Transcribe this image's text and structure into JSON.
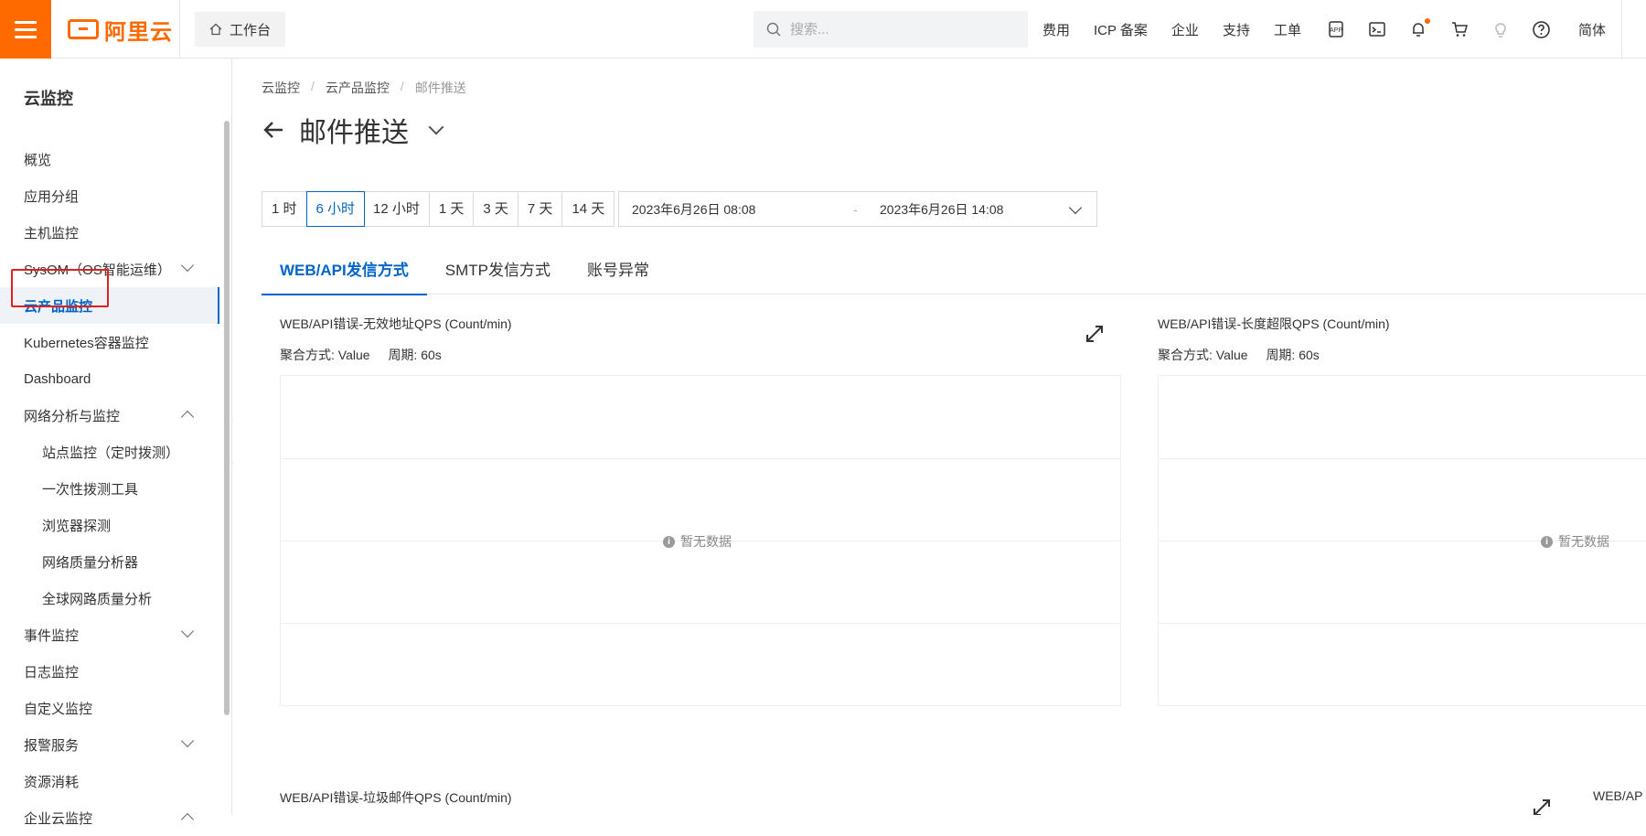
{
  "topbar": {
    "brand": "阿里云",
    "workbench_label": "工作台",
    "search_placeholder": "搜索...",
    "links": [
      "费用",
      "ICP 备案",
      "企业",
      "支持",
      "工单"
    ],
    "icons": [
      "app-icon",
      "terminal-icon",
      "bell-icon",
      "cart-icon",
      "lightbulb-icon",
      "help-icon"
    ],
    "lang": "简体"
  },
  "sidebar": {
    "title": "云监控",
    "items": [
      {
        "label": "概览",
        "level": 1
      },
      {
        "label": "应用分组",
        "level": 1
      },
      {
        "label": "主机监控",
        "level": 1
      },
      {
        "label": "SysOM（OS智能运维）",
        "level": 1,
        "expand": "down"
      },
      {
        "label": "云产品监控",
        "level": 1,
        "active": true
      },
      {
        "label": "Kubernetes容器监控",
        "level": 1
      },
      {
        "label": "Dashboard",
        "level": 1
      },
      {
        "label": "网络分析与监控",
        "level": 1,
        "expand": "up"
      },
      {
        "label": "站点监控（定时拨测）",
        "level": 2
      },
      {
        "label": "一次性拨测工具",
        "level": 2
      },
      {
        "label": "浏览器探测",
        "level": 2
      },
      {
        "label": "网络质量分析器",
        "level": 2
      },
      {
        "label": "全球网路质量分析",
        "level": 2
      },
      {
        "label": "事件监控",
        "level": 1,
        "expand": "down"
      },
      {
        "label": "日志监控",
        "level": 1
      },
      {
        "label": "自定义监控",
        "level": 1
      },
      {
        "label": "报警服务",
        "level": 1,
        "expand": "down"
      },
      {
        "label": "资源消耗",
        "level": 1
      },
      {
        "label": "企业云监控",
        "level": 1,
        "expand": "up"
      }
    ]
  },
  "breadcrumb": [
    "云监控",
    "云产品监控",
    "邮件推送"
  ],
  "page_title": "邮件推送",
  "time_ranges": [
    "1 时",
    "6 小时",
    "12 小时",
    "1 天",
    "3 天",
    "7 天",
    "14 天"
  ],
  "active_range": "6 小时",
  "date_range": {
    "start": "2023年6月26日 08:08",
    "separator": "-",
    "end": "2023年6月26日 14:08"
  },
  "tabs": [
    "WEB/API发信方式",
    "SMTP发信方式",
    "账号异常"
  ],
  "active_tab": "WEB/API发信方式",
  "charts": [
    {
      "title": "WEB/API错误-无效地址QPS (Count/min)",
      "aggregation": "聚合方式: Value",
      "period": "周期: 60s",
      "empty": "暂无数据"
    },
    {
      "title": "WEB/API错误-长度超限QPS (Count/min)",
      "aggregation": "聚合方式: Value",
      "period": "周期: 60s",
      "empty": "暂无数据"
    },
    {
      "title": "WEB/API错误-垃圾邮件QPS (Count/min)"
    },
    {
      "title": "WEB/AP"
    }
  ],
  "colors": {
    "brand": "#ff6a00",
    "accent": "#0064c8",
    "highlight": "#e02020"
  }
}
